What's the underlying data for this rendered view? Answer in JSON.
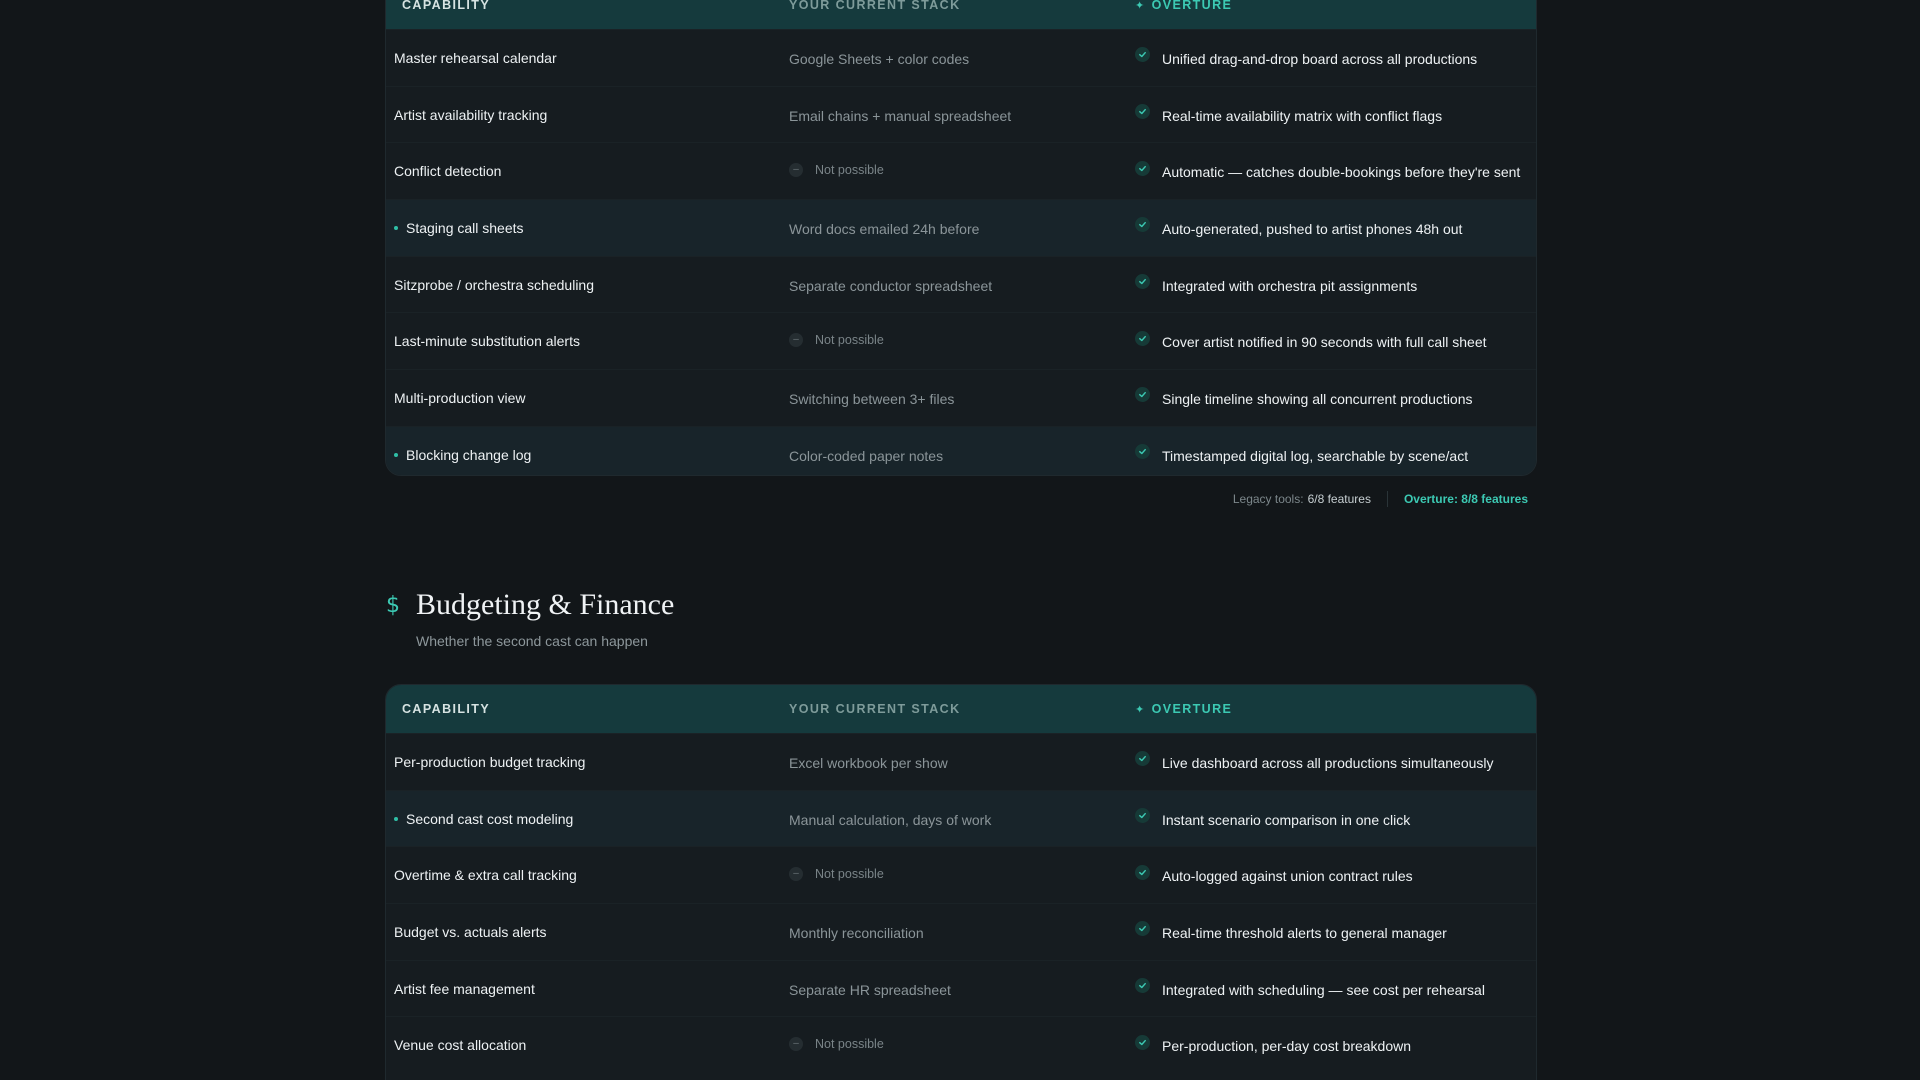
{
  "scheduling_table": {
    "headers": {
      "capability": "CAPABILITY",
      "current_stack": "YOUR CURRENT STACK",
      "overture": "OVERTURE",
      "overture_icon": "sparkle-icon"
    },
    "rows": [
      {
        "capability": "Master rehearsal calendar",
        "current": "Google Sheets + color codes",
        "overture": "Unified drag-and-drop board across all productions"
      },
      {
        "capability": "Artist availability tracking",
        "current": "Email chains + manual spreadsheet",
        "overture": "Real-time availability matrix with conflict flags"
      },
      {
        "capability": "Conflict detection",
        "current": "Not possible",
        "overture": "Automatic — catches double-bookings before they're sent"
      },
      {
        "capability": "Staging call sheets",
        "current": "Word docs emailed 24h before",
        "overture": "Auto-generated, pushed to artist phones 48h out"
      },
      {
        "capability": "Sitzprobe / orchestra scheduling",
        "current": "Separate conductor spreadsheet",
        "overture": "Integrated with orchestra pit assignments"
      },
      {
        "capability": "Last-minute substitution alerts",
        "current": "Not possible",
        "overture": "Cover artist notified in 90 seconds with full call sheet"
      },
      {
        "capability": "Multi-production view",
        "current": "Switching between 3+ files",
        "overture": "Single timeline showing all concurrent productions"
      },
      {
        "capability": "Blocking change log",
        "current": "Color-coded paper notes",
        "overture": "Timestamped digital log, searchable by scene/act"
      }
    ],
    "summary": {
      "legacy_label": "Legacy tools:",
      "legacy_value": "6/8 features",
      "overture_value": "Overture: 8/8 features"
    }
  },
  "budgeting_section": {
    "icon": "dollar-icon",
    "title": "Budgeting & Finance",
    "subtitle": "Whether the second cast can happen"
  },
  "budgeting_table": {
    "headers": {
      "capability": "CAPABILITY",
      "current_stack": "YOUR CURRENT STACK",
      "overture": "OVERTURE",
      "overture_icon": "sparkle-icon"
    },
    "rows": [
      {
        "capability": "Per-production budget tracking",
        "current": "Excel workbook per show",
        "overture": "Live dashboard across all productions simultaneously"
      },
      {
        "capability": "Second cast cost modeling",
        "current": "Manual calculation, days of work",
        "overture": "Instant scenario comparison in one click"
      },
      {
        "capability": "Overtime & extra call tracking",
        "current": "Not possible",
        "overture": "Auto-logged against union contract rules"
      },
      {
        "capability": "Budget vs. actuals alerts",
        "current": "Monthly reconciliation",
        "overture": "Real-time threshold alerts to general manager"
      },
      {
        "capability": "Artist fee management",
        "current": "Separate HR spreadsheet",
        "overture": "Integrated with scheduling — see cost per rehearsal"
      },
      {
        "capability": "Venue cost allocation",
        "current": "Not possible",
        "overture": "Per-production, per-day cost breakdown"
      }
    ]
  },
  "colors": {
    "background": "#121619",
    "accent": "#3cc9b3",
    "header_bg": "#153a3d",
    "highlight_row": "#18242a"
  }
}
